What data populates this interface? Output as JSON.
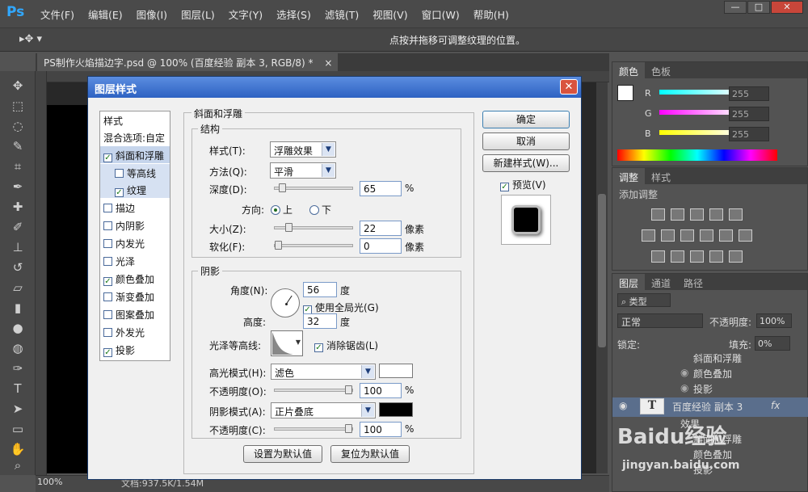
{
  "app": {
    "logo": "Ps"
  },
  "menu": [
    "文件(F)",
    "编辑(E)",
    "图像(I)",
    "图层(L)",
    "文字(Y)",
    "选择(S)",
    "滤镜(T)",
    "视图(V)",
    "窗口(W)",
    "帮助(H)"
  ],
  "window_buttons": [
    "—",
    "□",
    "✕"
  ],
  "options_bar": {
    "hint": "点按并拖移可调整纹理的位置。"
  },
  "document": {
    "tab_title": "PS制作火焰描边字.psd @ 100% (百度经验 副本 3, RGB/8) *",
    "close": "×",
    "zoom": "100%",
    "doc_size": "文档:937.5K/1.54M"
  },
  "color_panel": {
    "tabs": [
      "颜色",
      "色板"
    ],
    "channels": [
      {
        "label": "R",
        "value": "255"
      },
      {
        "label": "G",
        "value": "255"
      },
      {
        "label": "B",
        "value": "255"
      }
    ]
  },
  "adjust_panel": {
    "tabs": [
      "调整",
      "样式"
    ],
    "title": "添加调整"
  },
  "layers_panel": {
    "tabs": [
      "图层",
      "通道",
      "路径"
    ],
    "filter": "类型",
    "blend_mode": "正常",
    "opacity_label": "不透明度:",
    "opacity_value": "100%",
    "lock_label": "锁定:",
    "fill_label": "填充:",
    "fill_value": "0%",
    "rows": [
      {
        "name": "斜面和浮雕"
      },
      {
        "name": "颜色叠加"
      },
      {
        "name": "投影"
      },
      {
        "name": "百度经验 副本 3",
        "fx": "fx"
      },
      {
        "name": "效果"
      },
      {
        "name": "斜面和浮雕"
      },
      {
        "name": "颜色叠加"
      },
      {
        "name": "投影"
      }
    ]
  },
  "dialog": {
    "title": "图层样式",
    "close": "✕",
    "style_list": [
      {
        "label": "样式",
        "kind": "header"
      },
      {
        "label": "混合选项:自定",
        "kind": "header"
      },
      {
        "label": "斜面和浮雕",
        "checked": true,
        "selected": true
      },
      {
        "label": "等高线",
        "checked": false,
        "sub": true,
        "selected": true
      },
      {
        "label": "纹理",
        "checked": true,
        "sub": true,
        "selected": true
      },
      {
        "label": "描边",
        "checked": false
      },
      {
        "label": "内阴影",
        "checked": false
      },
      {
        "label": "内发光",
        "checked": false
      },
      {
        "label": "光泽",
        "checked": false
      },
      {
        "label": "颜色叠加",
        "checked": true
      },
      {
        "label": "渐变叠加",
        "checked": false
      },
      {
        "label": "图案叠加",
        "checked": false
      },
      {
        "label": "外发光",
        "checked": false
      },
      {
        "label": "投影",
        "checked": true
      }
    ],
    "bevel": {
      "title": "斜面和浮雕",
      "structure": {
        "title": "结构",
        "style_label": "样式(T):",
        "style_value": "浮雕效果",
        "technique_label": "方法(Q):",
        "technique_value": "平滑",
        "depth_label": "深度(D):",
        "depth_value": "65",
        "depth_unit": "%",
        "depth_level": 0.06,
        "direction_label": "方向:",
        "direction_up": "上",
        "direction_down": "下",
        "size_label": "大小(Z):",
        "size_value": "22",
        "size_unit": "像素",
        "size_level": 0.15,
        "soften_label": "软化(F):",
        "soften_value": "0",
        "soften_unit": "像素",
        "soften_level": 0.0
      },
      "shading": {
        "title": "阴影",
        "angle_label": "角度(N):",
        "angle_value": "56",
        "angle_unit": "度",
        "global_light": "使用全局光(G)",
        "altitude_label": "高度:",
        "altitude_value": "32",
        "altitude_unit": "度",
        "gloss_label": "光泽等高线:",
        "anti_alias": "消除锯齿(L)",
        "highlight_label": "高光模式(H):",
        "highlight_value": "滤色",
        "highlight_color": "#ffffff",
        "hl_opacity_label": "不透明度(O):",
        "hl_opacity_value": "100",
        "hl_opacity_unit": "%",
        "shadow_label": "阴影模式(A):",
        "shadow_value": "正片叠底",
        "shadow_color": "#000000",
        "sh_opacity_label": "不透明度(C):",
        "sh_opacity_value": "100",
        "sh_opacity_unit": "%"
      },
      "make_default": "设置为默认值",
      "reset_default": "复位为默认值"
    },
    "buttons": {
      "ok": "确定",
      "cancel": "取消",
      "new_style": "新建样式(W)...",
      "preview": "预览(V)"
    }
  },
  "watermark": {
    "text": "Baidu经验",
    "url": "jingyan.baidu.com"
  }
}
